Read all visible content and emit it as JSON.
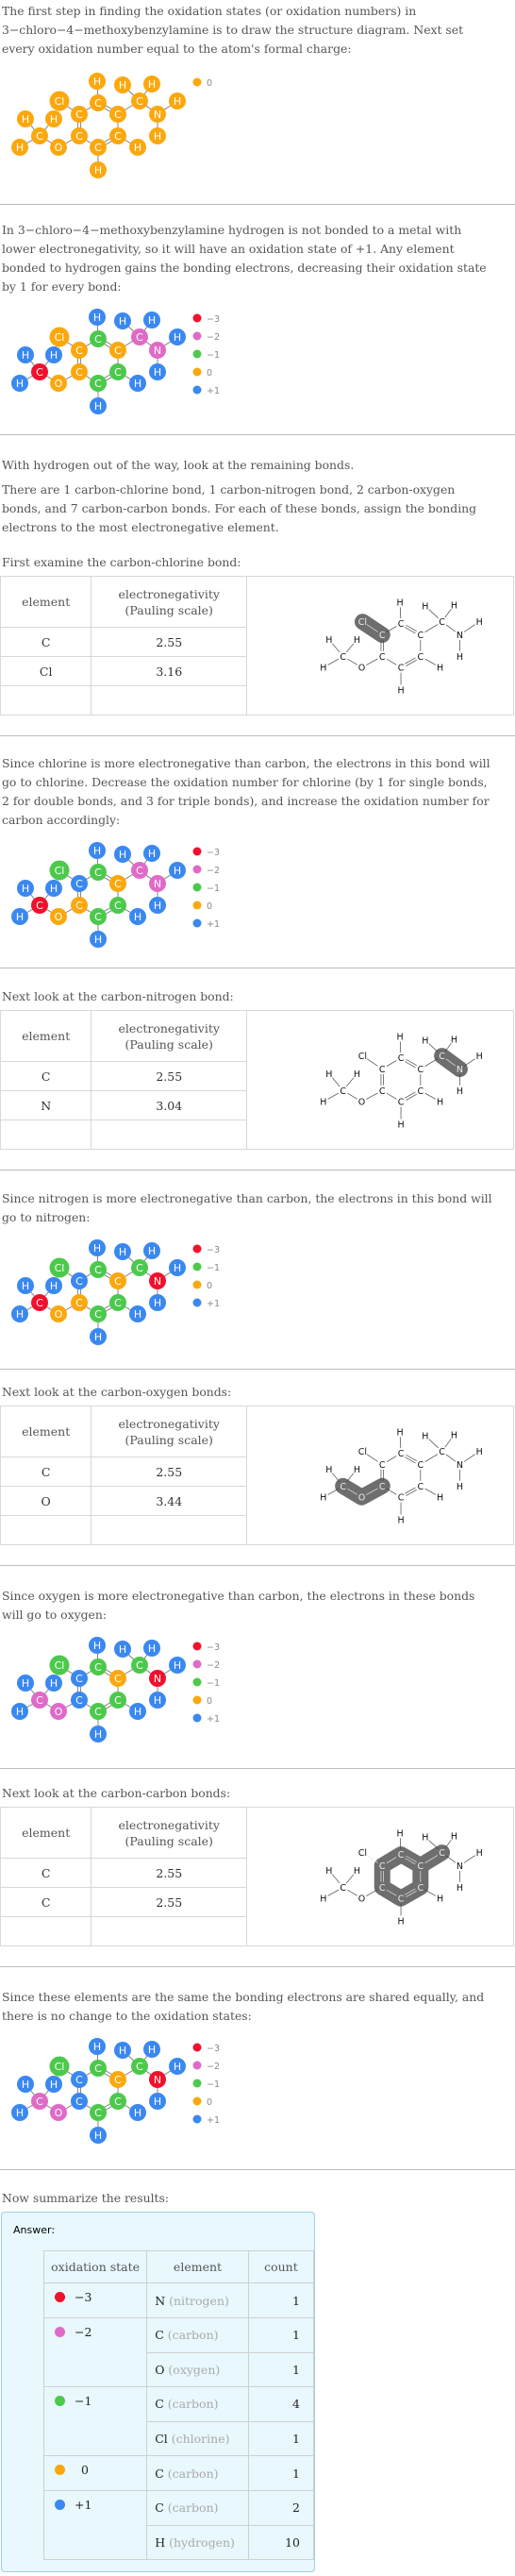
{
  "intro": {
    "line1": "The first step in finding the oxidation states (or oxidation numbers) in",
    "line2": "3−chloro−4−methoxybenzylamine is to draw the structure diagram. Next set",
    "line3": "every oxidation number equal to the atom's formal charge:"
  },
  "hydrogen_step": {
    "line1": "In 3−chloro−4−methoxybenzylamine hydrogen is not bonded to a metal with",
    "line2": "lower electronegativity, so it will have an oxidation state of +1. Any element",
    "line3": "bonded to hydrogen gains the bonding electrons, decreasing their oxidation state",
    "line4": "by 1 for every bond:"
  },
  "remaining": {
    "line1": "With hydrogen out of the way, look at the remaining bonds.",
    "p2_line1": "There are 1 carbon-chlorine bond, 1 carbon-nitrogen bond, 2 carbon-oxygen",
    "p2_line2": "bonds, and 7 carbon-carbon bonds.  For each of these bonds, assign the bonding",
    "p2_line3": "electrons to the most electronegative element."
  },
  "table_headers": {
    "element": "element",
    "en_line1": "electronegativity",
    "en_line2": "(Pauling scale)"
  },
  "bond_cl": {
    "intro": "First examine the carbon-chlorine bond:",
    "rows": [
      {
        "element": "C",
        "value": "2.55"
      },
      {
        "element": "Cl",
        "value": "3.16"
      }
    ],
    "result_line1": "Since chlorine is more electronegative than carbon, the electrons in this bond will",
    "result_line2": "go to chlorine. Decrease the oxidation number for chlorine (by 1 for single bonds,",
    "result_line3": "2 for double bonds, and 3 for triple bonds), and increase the oxidation number for",
    "result_line4": "carbon accordingly:"
  },
  "bond_n": {
    "intro": "Next look at the carbon-nitrogen bond:",
    "rows": [
      {
        "element": "C",
        "value": "2.55"
      },
      {
        "element": "N",
        "value": "3.04"
      }
    ],
    "result_line1": "Since nitrogen is more electronegative than carbon, the electrons in this bond will",
    "result_line2": "go to nitrogen:"
  },
  "bond_o": {
    "intro": "Next look at the carbon-oxygen bonds:",
    "rows": [
      {
        "element": "C",
        "value": "2.55"
      },
      {
        "element": "O",
        "value": "3.44"
      }
    ],
    "result_line1": "Since oxygen is more electronegative than carbon, the electrons in these bonds",
    "result_line2": "will go to oxygen:"
  },
  "bond_c": {
    "intro": "Next look at the carbon-carbon bonds:",
    "rows": [
      {
        "element": "C",
        "value": "2.55"
      },
      {
        "element": "C",
        "value": "2.55"
      }
    ],
    "result_line1": "Since these elements are the same the bonding electrons are shared equally, and",
    "result_line2": "there is no change to the oxidation states:"
  },
  "colors": {
    "-3": "#f0112d",
    "-2": "#e06ac8",
    "-1": "#4cc94c",
    "0": "#fba80e",
    "+1": "#3a88f0"
  },
  "molecule": {
    "atoms": [
      {
        "id": "H1",
        "el": "H"
      },
      {
        "id": "H2",
        "el": "H"
      },
      {
        "id": "H3",
        "el": "H"
      },
      {
        "id": "Cl",
        "el": "Cl"
      },
      {
        "id": "C2",
        "el": "C"
      },
      {
        "id": "C7",
        "el": "C"
      },
      {
        "id": "H4",
        "el": "H"
      },
      {
        "id": "C3",
        "el": "C"
      },
      {
        "id": "C1",
        "el": "C"
      },
      {
        "id": "N",
        "el": "N"
      },
      {
        "id": "H5",
        "el": "H"
      },
      {
        "id": "H6",
        "el": "H"
      },
      {
        "id": "C8",
        "el": "C"
      },
      {
        "id": "C4",
        "el": "C"
      },
      {
        "id": "C6",
        "el": "C"
      },
      {
        "id": "H7",
        "el": "H"
      },
      {
        "id": "H8",
        "el": "H"
      },
      {
        "id": "O",
        "el": "O"
      },
      {
        "id": "C5",
        "el": "C"
      },
      {
        "id": "H9",
        "el": "H"
      },
      {
        "id": "H10",
        "el": "H"
      }
    ]
  },
  "diagrams": [
    {
      "legend": [
        "0"
      ],
      "states": {
        "H1": "0",
        "H2": "0",
        "H3": "0",
        "Cl": "0",
        "C2": "0",
        "C7": "0",
        "H4": "0",
        "C3": "0",
        "C1": "0",
        "N": "0",
        "H5": "0",
        "H6": "0",
        "C8": "0",
        "C4": "0",
        "C6": "0",
        "H7": "0",
        "H8": "0",
        "O": "0",
        "C5": "0",
        "H9": "0",
        "H10": "0"
      }
    },
    {
      "legend": [
        "-3",
        "-2",
        "-1",
        "0",
        "+1"
      ],
      "states": {
        "H1": "+1",
        "H2": "+1",
        "H3": "+1",
        "Cl": "0",
        "C2": "-1",
        "C7": "-2",
        "H4": "+1",
        "C3": "0",
        "C1": "0",
        "N": "-2",
        "H5": "+1",
        "H6": "+1",
        "C8": "-3",
        "C4": "0",
        "C6": "-1",
        "H7": "+1",
        "H8": "+1",
        "O": "0",
        "C5": "-1",
        "H9": "+1",
        "H10": "+1"
      }
    },
    {
      "legend": [
        "-3",
        "-2",
        "-1",
        "0",
        "+1"
      ],
      "states": {
        "H1": "+1",
        "H2": "+1",
        "H3": "+1",
        "Cl": "-1",
        "C2": "-1",
        "C7": "-2",
        "H4": "+1",
        "C3": "+1",
        "C1": "0",
        "N": "-2",
        "H5": "+1",
        "H6": "+1",
        "C8": "-3",
        "C4": "0",
        "C6": "-1",
        "H7": "+1",
        "H8": "+1",
        "O": "0",
        "C5": "-1",
        "H9": "+1",
        "H10": "+1"
      }
    },
    {
      "legend": [
        "-3",
        "-1",
        "0",
        "+1"
      ],
      "states": {
        "H1": "+1",
        "H2": "+1",
        "H3": "+1",
        "Cl": "-1",
        "C2": "-1",
        "C7": "-1",
        "H4": "+1",
        "C3": "+1",
        "C1": "0",
        "N": "-3",
        "H5": "+1",
        "H6": "+1",
        "C8": "-3",
        "C4": "0",
        "C6": "-1",
        "H7": "+1",
        "H8": "+1",
        "O": "0",
        "C5": "-1",
        "H9": "+1",
        "H10": "+1"
      }
    },
    {
      "legend": [
        "-3",
        "-2",
        "-1",
        "0",
        "+1"
      ],
      "states": {
        "H1": "+1",
        "H2": "+1",
        "H3": "+1",
        "Cl": "-1",
        "C2": "-1",
        "C7": "-1",
        "H4": "+1",
        "C3": "+1",
        "C1": "0",
        "N": "-3",
        "H5": "+1",
        "H6": "+1",
        "C8": "-2",
        "C4": "+1",
        "C6": "-1",
        "H7": "+1",
        "H8": "+1",
        "O": "-2",
        "C5": "-1",
        "H9": "+1",
        "H10": "+1"
      }
    },
    {
      "legend": [
        "-3",
        "-2",
        "-1",
        "0",
        "+1"
      ],
      "states": {
        "H1": "+1",
        "H2": "+1",
        "H3": "+1",
        "Cl": "-1",
        "C2": "-1",
        "C7": "-1",
        "H4": "+1",
        "C3": "+1",
        "C1": "0",
        "N": "-3",
        "H5": "+1",
        "H6": "+1",
        "C8": "-2",
        "C4": "+1",
        "C6": "-1",
        "H7": "+1",
        "H8": "+1",
        "O": "-2",
        "C5": "-1",
        "H9": "+1",
        "H10": "+1"
      }
    }
  ],
  "highlights": {
    "cl": [
      "Cl",
      "C3"
    ],
    "n": [
      "C7",
      "N"
    ],
    "o": [
      "C8",
      "O",
      "C4"
    ],
    "c": [
      "C3",
      "C2",
      "C1",
      "C6",
      "C5",
      "C4",
      "C7"
    ]
  },
  "summary": {
    "intro": "Now summarize the results:",
    "answer_label": "Answer:",
    "headers": [
      "oxidation state",
      "element",
      "count"
    ],
    "groups": [
      {
        "state": "−3",
        "color": "#f0112d",
        "rows": [
          {
            "symbol": "N",
            "name": "(nitrogen)",
            "count": "1"
          }
        ]
      },
      {
        "state": "−2",
        "color": "#e06ac8",
        "rows": [
          {
            "symbol": "C",
            "name": "(carbon)",
            "count": "1"
          },
          {
            "symbol": "O",
            "name": "(oxygen)",
            "count": "1"
          }
        ]
      },
      {
        "state": "−1",
        "color": "#4cc94c",
        "rows": [
          {
            "symbol": "C",
            "name": "(carbon)",
            "count": "4"
          },
          {
            "symbol": "Cl",
            "name": "(chlorine)",
            "count": "1"
          }
        ]
      },
      {
        "state": "0",
        "color": "#fba80e",
        "rows": [
          {
            "symbol": "C",
            "name": "(carbon)",
            "count": "1"
          }
        ]
      },
      {
        "state": "+1",
        "color": "#3a88f0",
        "rows": [
          {
            "symbol": "C",
            "name": "(carbon)",
            "count": "2"
          },
          {
            "symbol": "H",
            "name": "(hydrogen)",
            "count": "10"
          }
        ]
      }
    ]
  }
}
